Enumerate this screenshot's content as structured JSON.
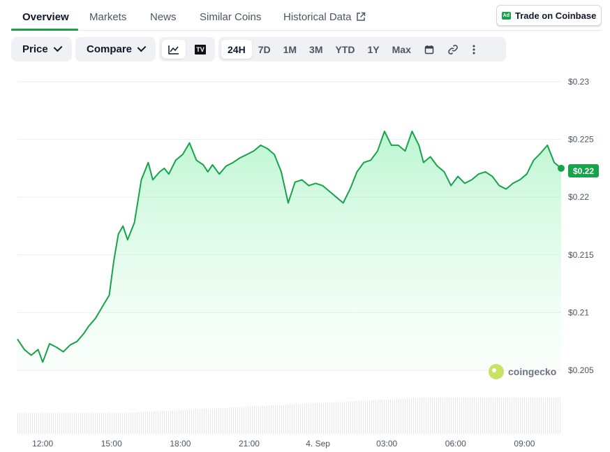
{
  "tabs": [
    {
      "label": "Overview",
      "active": true
    },
    {
      "label": "Markets"
    },
    {
      "label": "News"
    },
    {
      "label": "Similar Coins"
    },
    {
      "label": "Historical Data",
      "icon": "external-link-icon"
    }
  ],
  "trade_button": {
    "badge": "Ad",
    "label": "Trade on Coinbase"
  },
  "controls": {
    "price_label": "Price",
    "compare_label": "Compare",
    "chart_style_icons": [
      "line-chart-icon",
      "tradingview-icon"
    ],
    "tradingview_glyph": "TV",
    "ranges": [
      "24H",
      "7D",
      "1M",
      "3M",
      "YTD",
      "1Y",
      "Max"
    ],
    "active_range": "24H",
    "extra_icons": [
      "calendar-icon",
      "link-icon",
      "more-icon"
    ]
  },
  "current_price": "$0.22",
  "watermark": "coingecko",
  "colors": {
    "accent": "#16a34a",
    "line": "#16a34a",
    "area": "#bbf7d0"
  },
  "chart_data": {
    "type": "area",
    "title": "",
    "xlabel": "",
    "ylabel": "",
    "y_ticks": [
      0.205,
      0.21,
      0.215,
      0.22,
      0.225,
      0.23
    ],
    "y_tick_labels": [
      "$0.205",
      "$0.21",
      "$0.215",
      "$0.22",
      "$0.225",
      "$0.23"
    ],
    "ylim": [
      0.205,
      0.23
    ],
    "x_tick_labels": [
      "12:00",
      "15:00",
      "18:00",
      "21:00",
      "4. Sep",
      "03:00",
      "06:00",
      "09:00"
    ],
    "x_range_hours": [
      10.9,
      34.6
    ],
    "grid": true,
    "series": [
      {
        "x": [
          10.9,
          11.2,
          11.5,
          11.8,
          12.0,
          12.3,
          12.6,
          12.9,
          13.2,
          13.5,
          13.8,
          14.0,
          14.3,
          14.6,
          14.9,
          15.1,
          15.3,
          15.5,
          15.7,
          16.0,
          16.3,
          16.6,
          16.8,
          17.1,
          17.3,
          17.5,
          17.8,
          18.1,
          18.4,
          18.7,
          19.0,
          19.2,
          19.4,
          19.7,
          20.0,
          20.3,
          20.6,
          20.9,
          21.2,
          21.5,
          21.8,
          22.1,
          22.4,
          22.7,
          23.0,
          23.3,
          23.6,
          23.9,
          24.2,
          24.5,
          24.8,
          25.1,
          25.4,
          25.7,
          26.0,
          26.3,
          26.6,
          26.9,
          27.2,
          27.5,
          27.8,
          28.1,
          28.4,
          28.6,
          28.9,
          29.2,
          29.5,
          29.8,
          30.1,
          30.4,
          30.7,
          31.0,
          31.3,
          31.6,
          31.9,
          32.2,
          32.5,
          32.8,
          33.1,
          33.4,
          33.7,
          34.0,
          34.3,
          34.6
        ],
        "y": [
          0.2077,
          0.2068,
          0.2063,
          0.2068,
          0.2057,
          0.2073,
          0.207,
          0.2066,
          0.2072,
          0.2075,
          0.2082,
          0.2088,
          0.2095,
          0.2105,
          0.2115,
          0.2145,
          0.2168,
          0.2175,
          0.2163,
          0.2178,
          0.2215,
          0.223,
          0.2215,
          0.2222,
          0.2225,
          0.222,
          0.2232,
          0.2237,
          0.2247,
          0.2232,
          0.2228,
          0.2222,
          0.2228,
          0.222,
          0.2227,
          0.223,
          0.2234,
          0.2237,
          0.224,
          0.2245,
          0.2242,
          0.2237,
          0.2222,
          0.2195,
          0.2213,
          0.2215,
          0.221,
          0.2212,
          0.221,
          0.2205,
          0.22,
          0.2195,
          0.2207,
          0.2222,
          0.223,
          0.2232,
          0.224,
          0.2257,
          0.2245,
          0.2245,
          0.224,
          0.2257,
          0.2245,
          0.223,
          0.2235,
          0.2227,
          0.2222,
          0.221,
          0.2218,
          0.2212,
          0.2215,
          0.222,
          0.2222,
          0.2218,
          0.221,
          0.2207,
          0.2212,
          0.2215,
          0.222,
          0.2232,
          0.2238,
          0.2245,
          0.223,
          0.2225
        ]
      }
    ],
    "volume_bars": true
  }
}
